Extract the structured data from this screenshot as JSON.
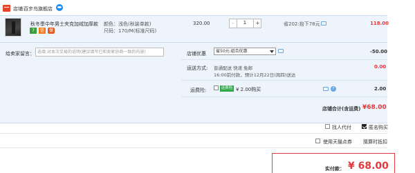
{
  "store": {
    "label": "店铺:",
    "name": "百步鸟旗舰店",
    "chat_icon": "wangwang-icon"
  },
  "item": {
    "title": "秋冬季中年男士夹克加绒加厚款...",
    "badges": [
      "7",
      "信",
      "保"
    ],
    "color": "颜色：浅色(秋装单款)",
    "size": "尺码：170/M(标准尺码)",
    "unit_price": "320.00",
    "quantity": "1",
    "qty_minus": "-",
    "qty_plus": "+",
    "discount": "省202:抬下78元",
    "subtotal": "118.00"
  },
  "details": {
    "message_label": "给卖家留言：",
    "message_placeholder": "选填:对本次交易的说明(建议填写已和卖家协商一致的内容)",
    "coupon_label": "店铺优惠",
    "coupon_selected": "省50元:组合优惠",
    "coupon_amount": "-50.00",
    "shipping_label": "运送方式:",
    "shipping_line1": "普通配送 快递 免邮",
    "shipping_line2": "16:00前付款，预计12月22日(周四)送达",
    "shipping_amount": "0.00",
    "insurance_label": "运费险:",
    "insurance_badge": "运费险",
    "insurance_text": "¥ 2.00购买",
    "insurance_amount": "2.00",
    "total_label": "店铺合计(含运费)",
    "total_amount": "¥68.00"
  },
  "options": {
    "proxy_pay": "找人代付",
    "anonymous": "匿名购买",
    "anonymous_checked": true,
    "tmall_points": "使用天猫点券",
    "points_hint": "猜算时抵扣"
  },
  "payment": {
    "label": "实付款：",
    "amount": "¥ 68.00"
  },
  "colors": {
    "accent_red": "#e4393c",
    "row_bg": "#eef4fc",
    "row_border": "#c9dcf2"
  }
}
